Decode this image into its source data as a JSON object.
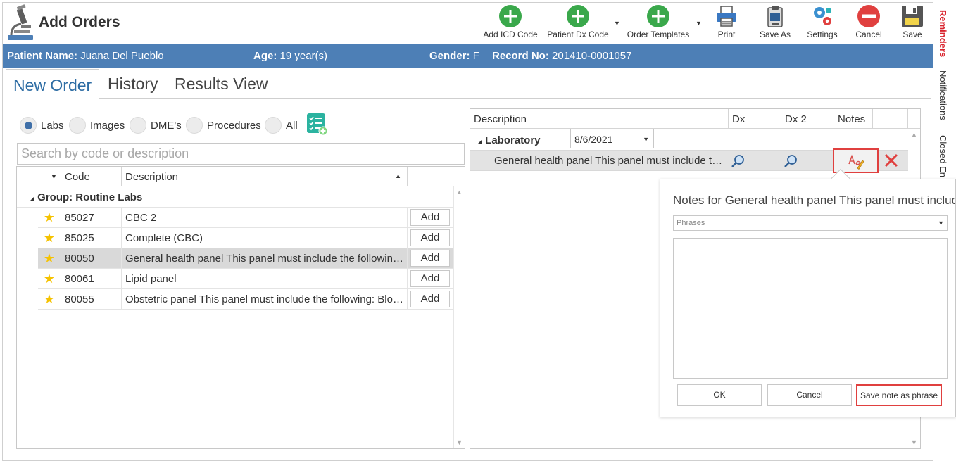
{
  "header": {
    "title": "Add Orders",
    "toolbar": [
      {
        "id": "add-icd",
        "label": "Add ICD Code",
        "icon": "plus-circle-icon"
      },
      {
        "id": "patient-dx",
        "label": "Patient Dx Code",
        "icon": "plus-circle-icon"
      },
      {
        "id": "order-templates",
        "label": "Order Templates",
        "icon": "plus-circle-icon"
      },
      {
        "id": "print",
        "label": "Print",
        "icon": "printer-icon"
      },
      {
        "id": "save-as",
        "label": "Save As",
        "icon": "clipboard-icon"
      },
      {
        "id": "settings",
        "label": "Settings",
        "icon": "gears-icon"
      },
      {
        "id": "cancel",
        "label": "Cancel",
        "icon": "no-entry-icon"
      },
      {
        "id": "save",
        "label": "Save",
        "icon": "floppy-disk-icon"
      }
    ]
  },
  "patient": {
    "name_label": "Patient Name:",
    "name": "Juana Del Pueblo",
    "age_label": "Age:",
    "age": "19 year(s)",
    "gender_label": "Gender:",
    "gender": "F",
    "record_label": "Record No:",
    "record": "201410-0001057"
  },
  "side_tabs": {
    "reminders": "Reminders",
    "notifications": "Notifications",
    "closed": "Closed En"
  },
  "tabs": {
    "new_order": "New Order",
    "history": "History",
    "results_view": "Results View"
  },
  "filters": {
    "labs": "Labs",
    "images": "Images",
    "dmes": "DME's",
    "procedures": "Procedures",
    "all": "All",
    "selected": "Labs"
  },
  "search": {
    "placeholder": "Search by code or description"
  },
  "left_grid": {
    "headers": {
      "code": "Code",
      "description": "Description"
    },
    "group": "Group: Routine Labs",
    "add_label": "Add",
    "rows": [
      {
        "code": "85027",
        "description": "CBC 2"
      },
      {
        "code": "85025",
        "description": "Complete (CBC)"
      },
      {
        "code": "80050",
        "description": "General health panel This panel must include the following: Comprehensive metabolic panel"
      },
      {
        "code": "80061",
        "description": "Lipid panel"
      },
      {
        "code": "80055",
        "description": "Obstetric panel This panel must include the following: Blood count, complete"
      }
    ]
  },
  "right_grid": {
    "headers": {
      "description": "Description",
      "dx": "Dx",
      "dx2": "Dx 2",
      "notes": "Notes"
    },
    "group": "Laboratory",
    "date": "8/6/2021",
    "order_description": "General health panel This panel must include the following"
  },
  "notes_popup": {
    "title": "Notes for General health panel This panel must include the following",
    "phrases_placeholder": "Phrases",
    "ok": "OK",
    "cancel": "Cancel",
    "save_phrase": "Save note as phrase"
  },
  "colors": {
    "accent": "#4d7fb6",
    "tab_active": "#2e6da4",
    "highlight": "#e0403f",
    "star": "#f5c200",
    "add_green": "#3aa84b"
  }
}
